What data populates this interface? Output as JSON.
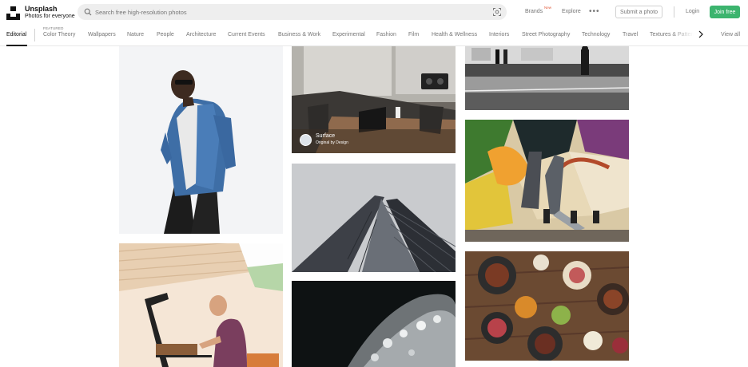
{
  "brand": {
    "title": "Unsplash",
    "tagline": "Photos for everyone"
  },
  "search": {
    "placeholder": "Search free high-resolution photos"
  },
  "header_nav": {
    "brands": "Brands",
    "brands_badge": "New",
    "explore": "Explore",
    "more": "•••",
    "submit": "Submit a photo",
    "login": "Login",
    "join": "Join free"
  },
  "topics": {
    "active": "Editorial",
    "featured_label": "FEATURED",
    "items": [
      "Color Theory",
      "Wallpapers",
      "Nature",
      "People",
      "Architecture",
      "Current Events",
      "Business & Work",
      "Experimental",
      "Fashion",
      "Film",
      "Health & Wellness",
      "Interiors",
      "Street Photography",
      "Technology",
      "Travel",
      "Textures & Patterns"
    ],
    "view_all": "View all"
  },
  "photos": {
    "sponsored": {
      "name": "Surface",
      "subtitle": "Original by Design"
    }
  },
  "colors": {
    "accent_green": "#3cb46e",
    "badge_red": "#e25c3d",
    "muted_text": "#767676"
  }
}
